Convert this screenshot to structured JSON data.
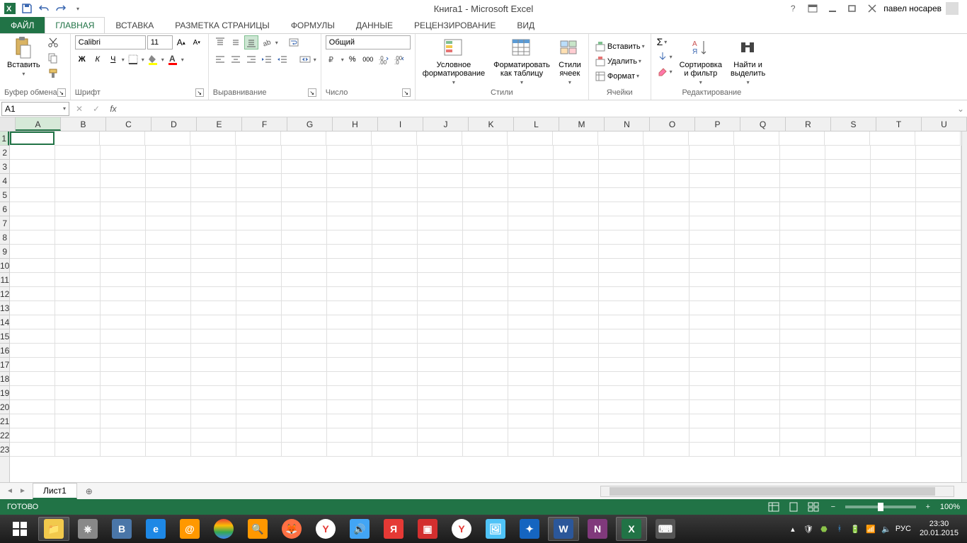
{
  "title": "Книга1 - Microsoft Excel",
  "user_name": "павел носарев",
  "tabs": {
    "file": "ФАЙЛ",
    "home": "ГЛАВНАЯ",
    "insert": "ВСТАВКА",
    "page_layout": "РАЗМЕТКА СТРАНИЦЫ",
    "formulas": "ФОРМУЛЫ",
    "data": "ДАННЫЕ",
    "review": "РЕЦЕНЗИРОВАНИЕ",
    "view": "ВИД"
  },
  "ribbon": {
    "clipboard": {
      "title": "Буфер обмена",
      "paste": "Вставить"
    },
    "font": {
      "title": "Шрифт",
      "name": "Calibri",
      "size": "11"
    },
    "alignment": {
      "title": "Выравнивание"
    },
    "number": {
      "title": "Число",
      "format": "Общий"
    },
    "styles": {
      "title": "Стили",
      "conditional": "Условное\nформатирование",
      "as_table": "Форматировать\nкак таблицу",
      "cell_styles": "Стили\nячеек"
    },
    "cells": {
      "title": "Ячейки",
      "insert": "Вставить",
      "delete": "Удалить",
      "format": "Формат"
    },
    "editing": {
      "title": "Редактирование",
      "sort_filter": "Сортировка\nи фильтр",
      "find_select": "Найти и\nвыделить"
    }
  },
  "formula_bar": {
    "namebox": "A1",
    "fx": "fx"
  },
  "columns": [
    "A",
    "B",
    "C",
    "D",
    "E",
    "F",
    "G",
    "H",
    "I",
    "J",
    "K",
    "L",
    "M",
    "N",
    "O",
    "P",
    "Q",
    "R",
    "S",
    "T",
    "U"
  ],
  "rows": [
    "1",
    "2",
    "3",
    "4",
    "5",
    "6",
    "7",
    "8",
    "9",
    "10",
    "11",
    "12",
    "13",
    "14",
    "15",
    "16",
    "17",
    "18",
    "19",
    "20",
    "21",
    "22",
    "23"
  ],
  "sheet_tab": "Лист1",
  "status": {
    "ready": "ГОТОВО",
    "zoom": "100%"
  },
  "taskbar": {
    "lang": "РУС",
    "time": "23:30",
    "date": "20.01.2015"
  },
  "bold": "Ж",
  "italic": "К",
  "underline": "Ч",
  "currency_icon": "%"
}
